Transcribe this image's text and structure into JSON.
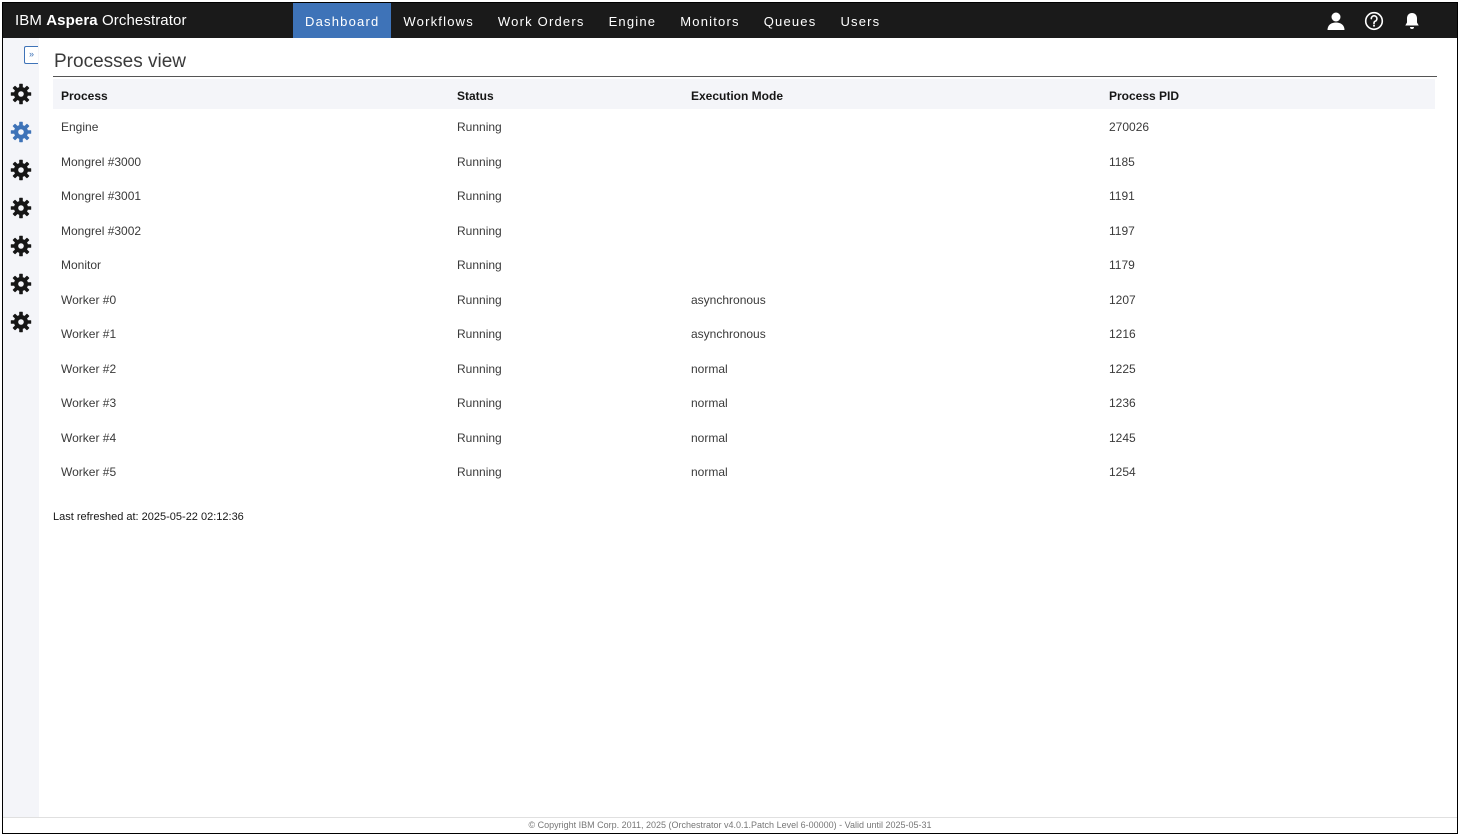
{
  "brand": {
    "prefix": "IBM",
    "bold": "Aspera",
    "suffix": "Orchestrator"
  },
  "nav": [
    {
      "label": "Dashboard",
      "active": true
    },
    {
      "label": "Workflows",
      "active": false
    },
    {
      "label": "Work Orders",
      "active": false
    },
    {
      "label": "Engine",
      "active": false
    },
    {
      "label": "Monitors",
      "active": false
    },
    {
      "label": "Queues",
      "active": false
    },
    {
      "label": "Users",
      "active": false
    }
  ],
  "top_icons": [
    "user-icon",
    "help-icon",
    "bell-icon"
  ],
  "sidebar": {
    "expand_label": "»",
    "icons": [
      {
        "name": "gear-icon",
        "color": "#161616"
      },
      {
        "name": "gear-icon",
        "color": "#3e73b8"
      },
      {
        "name": "gear-icon",
        "color": "#161616"
      },
      {
        "name": "gear-icon",
        "color": "#161616"
      },
      {
        "name": "gear-icon",
        "color": "#161616"
      },
      {
        "name": "gear-icon",
        "color": "#161616"
      },
      {
        "name": "gear-icon",
        "color": "#161616"
      }
    ]
  },
  "main": {
    "title": "Processes view",
    "table": {
      "headers": [
        "Process",
        "Status",
        "Execution Mode",
        "Process PID"
      ],
      "rows": [
        [
          "Engine",
          "Running",
          "",
          "270026"
        ],
        [
          "Mongrel #3000",
          "Running",
          "",
          "1185"
        ],
        [
          "Mongrel #3001",
          "Running",
          "",
          "1191"
        ],
        [
          "Mongrel #3002",
          "Running",
          "",
          "1197"
        ],
        [
          "Monitor",
          "Running",
          "",
          "1179"
        ],
        [
          "Worker #0",
          "Running",
          "asynchronous",
          "1207"
        ],
        [
          "Worker #1",
          "Running",
          "asynchronous",
          "1216"
        ],
        [
          "Worker #2",
          "Running",
          "normal",
          "1225"
        ],
        [
          "Worker #3",
          "Running",
          "normal",
          "1236"
        ],
        [
          "Worker #4",
          "Running",
          "normal",
          "1245"
        ],
        [
          "Worker #5",
          "Running",
          "normal",
          "1254"
        ]
      ]
    },
    "last_refreshed": "Last refreshed at: 2025-05-22 02:12:36"
  },
  "footer": "© Copyright IBM Corp. 2011, 2025 (Orchestrator v4.0.1.Patch Level 6-00000) - Valid until 2025-05-31",
  "colors": {
    "topbar": "#1a1a1a",
    "accent": "#3e73b8",
    "sidebar": "#f4f5f9"
  }
}
